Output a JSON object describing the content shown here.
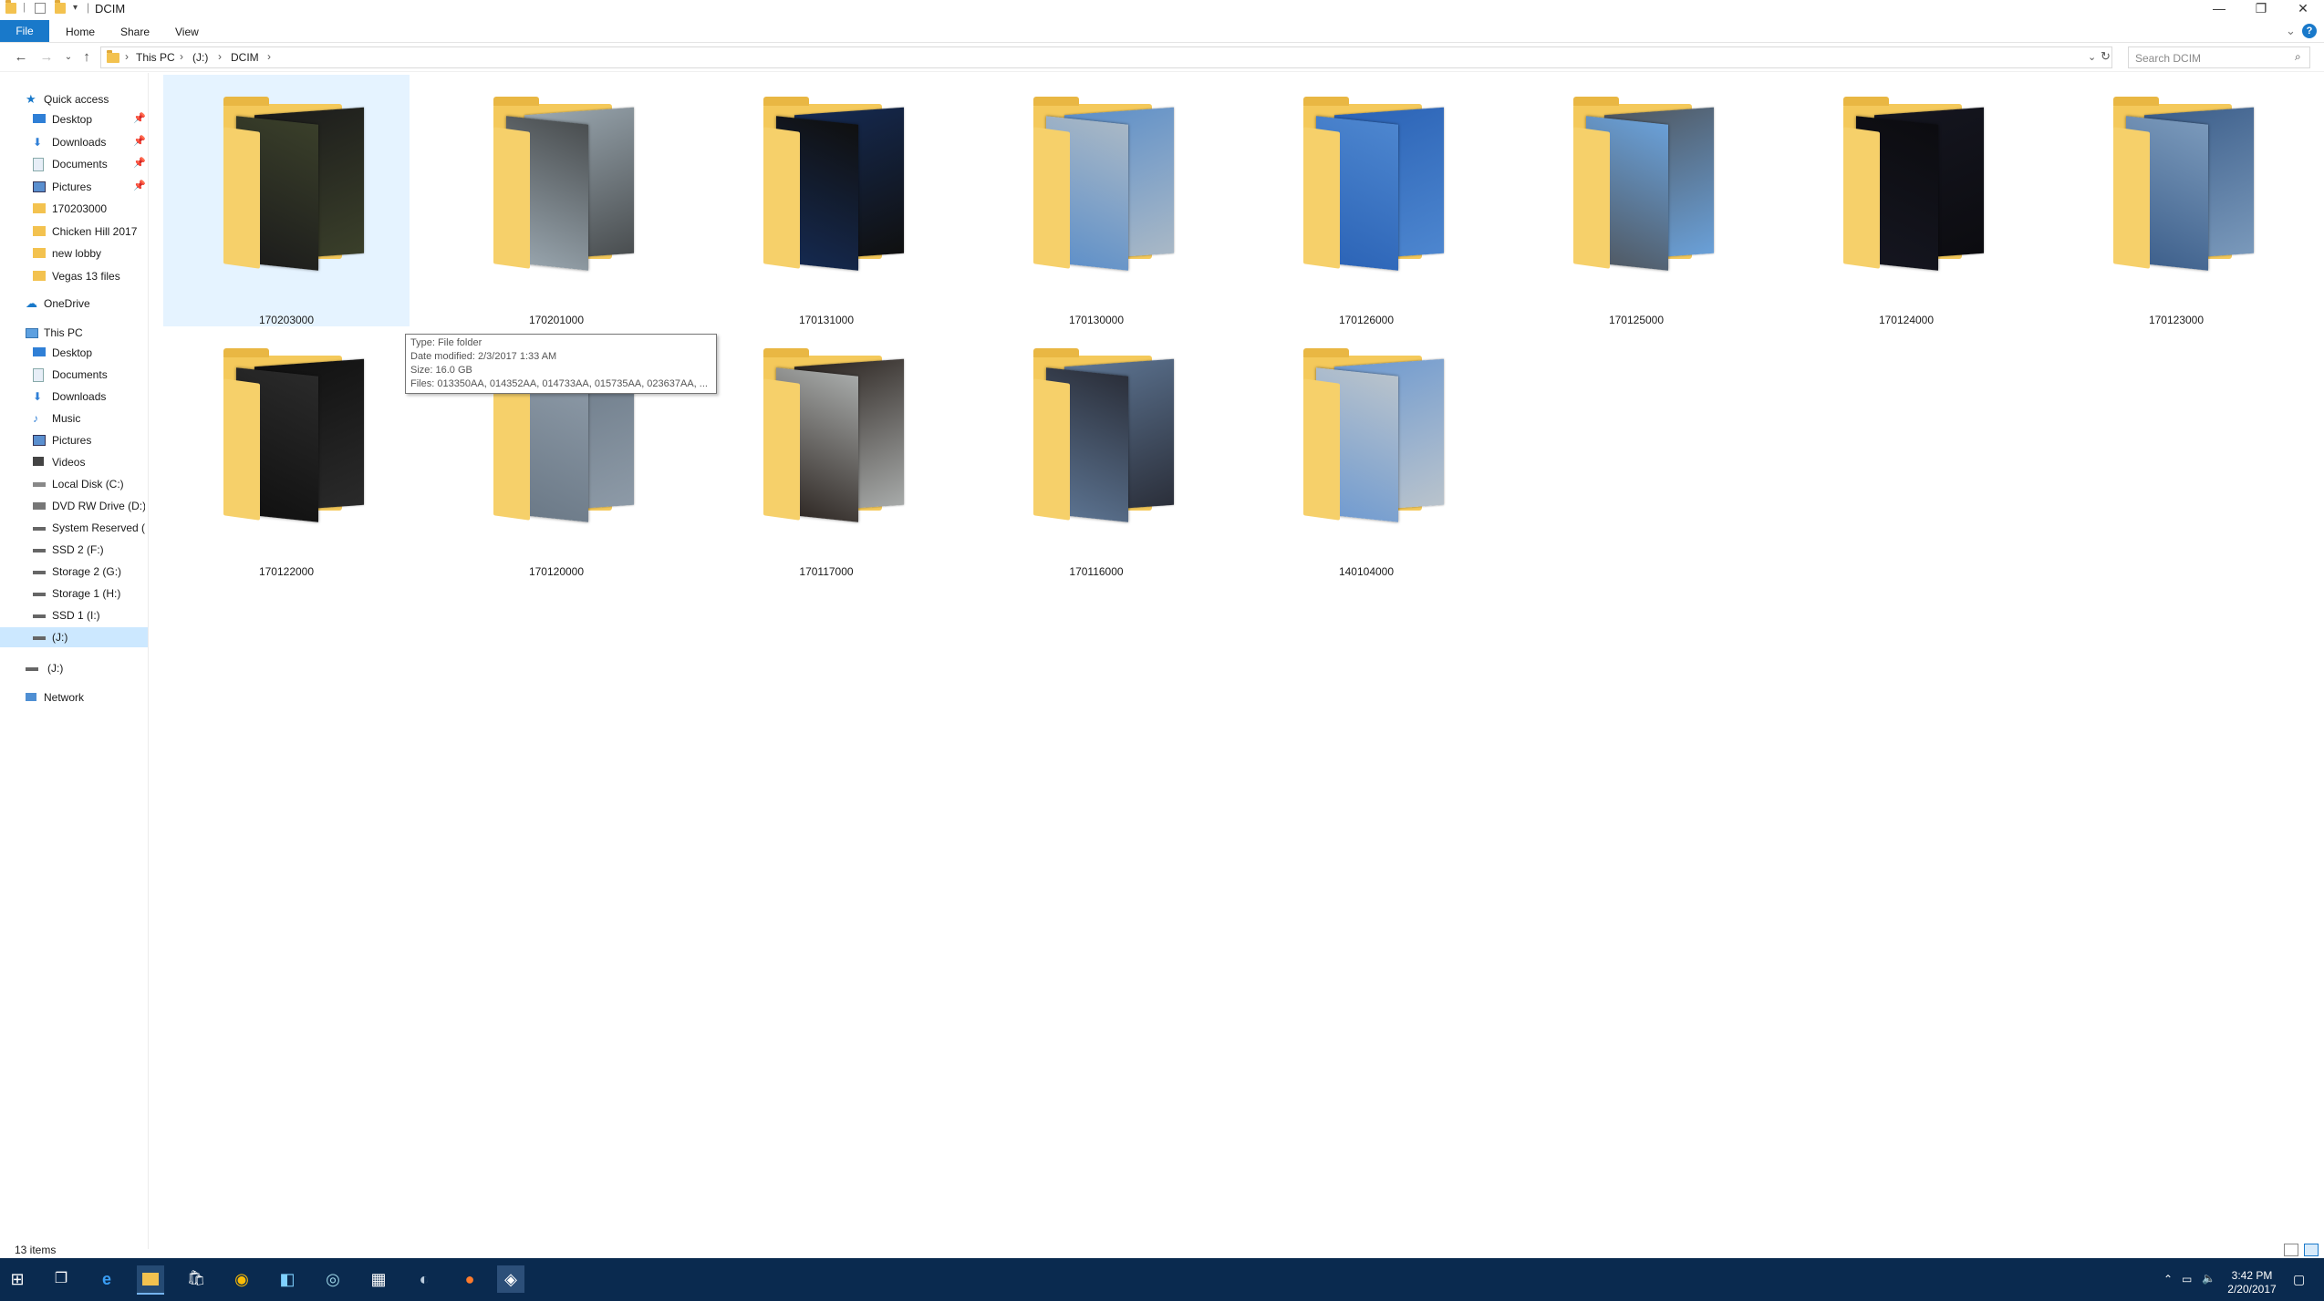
{
  "window": {
    "title": "DCIM",
    "minimize_glyph": "—",
    "restore_glyph": "❐",
    "close_glyph": "✕"
  },
  "ribbon": {
    "tabs": [
      {
        "label": "File"
      },
      {
        "label": "Home"
      },
      {
        "label": "Share"
      },
      {
        "label": "View"
      }
    ],
    "help_glyph": "?",
    "expand_glyph": "⌄"
  },
  "address": {
    "crumbs": [
      "This PC",
      "(J:)",
      "DCIM"
    ],
    "search_placeholder": "Search DCIM"
  },
  "navpane": {
    "quick_access": {
      "label": "Quick access"
    },
    "quick_items": [
      {
        "label": "Desktop",
        "icon": "desktop-icon",
        "pinned": true
      },
      {
        "label": "Downloads",
        "icon": "downloads-icon",
        "pinned": true
      },
      {
        "label": "Documents",
        "icon": "documents-icon",
        "pinned": true
      },
      {
        "label": "Pictures",
        "icon": "pictures-icon",
        "pinned": true
      },
      {
        "label": "170203000",
        "icon": "folder-icon",
        "pinned": false
      },
      {
        "label": "Chicken Hill 2017",
        "icon": "folder-icon",
        "pinned": false
      },
      {
        "label": "new lobby",
        "icon": "folder-icon",
        "pinned": false
      },
      {
        "label": "Vegas 13 files",
        "icon": "folder-icon",
        "pinned": false
      }
    ],
    "onedrive": {
      "label": "OneDrive"
    },
    "this_pc": {
      "label": "This PC"
    },
    "pc_items": [
      {
        "label": "Desktop",
        "icon": "desktop-icon"
      },
      {
        "label": "Documents",
        "icon": "documents-icon"
      },
      {
        "label": "Downloads",
        "icon": "downloads-icon"
      },
      {
        "label": "Music",
        "icon": "music-icon"
      },
      {
        "label": "Pictures",
        "icon": "pictures-icon"
      },
      {
        "label": "Videos",
        "icon": "videos-icon"
      },
      {
        "label": "Local Disk (C:)",
        "icon": "disk-icon"
      },
      {
        "label": "DVD RW Drive (D:) \\",
        "icon": "dvd-icon"
      },
      {
        "label": "System Reserved (E:",
        "icon": "drive-icon"
      },
      {
        "label": "SSD 2  (F:)",
        "icon": "drive-icon"
      },
      {
        "label": "Storage 2 (G:)",
        "icon": "drive-icon"
      },
      {
        "label": "Storage 1 (H:)",
        "icon": "drive-icon"
      },
      {
        "label": "SSD 1  (I:)",
        "icon": "drive-icon"
      },
      {
        "label": "(J:)",
        "icon": "drive-icon"
      }
    ],
    "j_drive": {
      "label": "(J:)"
    },
    "network": {
      "label": "Network"
    }
  },
  "folders": [
    {
      "name": "170203000",
      "selected": true,
      "c1": "#1b1b1b",
      "c2": "#3a3f2a"
    },
    {
      "name": "170201000",
      "selected": false,
      "c1": "#9aa7b0",
      "c2": "#4a4e50"
    },
    {
      "name": "170131000",
      "selected": false,
      "c1": "#152a52",
      "c2": "#101010"
    },
    {
      "name": "170130000",
      "selected": false,
      "c1": "#5d8fc9",
      "c2": "#a9b8c6"
    },
    {
      "name": "170126000",
      "selected": false,
      "c1": "#2b63b6",
      "c2": "#4d86cf"
    },
    {
      "name": "170125000",
      "selected": false,
      "c1": "#4f5760",
      "c2": "#6aa0d8"
    },
    {
      "name": "170124000",
      "selected": false,
      "c1": "#151620",
      "c2": "#0c0c10"
    },
    {
      "name": "170123000",
      "selected": false,
      "c1": "#3c5e8a",
      "c2": "#7a99bb"
    },
    {
      "name": "170122000",
      "selected": false,
      "c1": "#101010",
      "c2": "#2a2a2a"
    },
    {
      "name": "170120000",
      "selected": false,
      "c1": "#6a7886",
      "c2": "#8d9aa7"
    },
    {
      "name": "170117000",
      "selected": false,
      "c1": "#2b2420",
      "c2": "#a7aaa9"
    },
    {
      "name": "170116000",
      "selected": false,
      "c1": "#5d7593",
      "c2": "#2b2f3a"
    },
    {
      "name": "140104000",
      "selected": false,
      "c1": "#6f9ad0",
      "c2": "#b9c3cc"
    }
  ],
  "tooltip": {
    "type": "Type: File folder",
    "modified": "Date modified: 2/3/2017 1:33 AM",
    "size": "Size: 16.0 GB",
    "files": "Files: 013350AA, 014352AA, 014733AA, 015735AA, 023637AA, ..."
  },
  "status": {
    "count": "13 items"
  },
  "taskbar": {
    "time": "3:42 PM",
    "date": "2/20/2017"
  },
  "colors": {
    "accent": "#1979ca",
    "selection": "#cce8ff",
    "taskbar": "#0a2a4f"
  }
}
